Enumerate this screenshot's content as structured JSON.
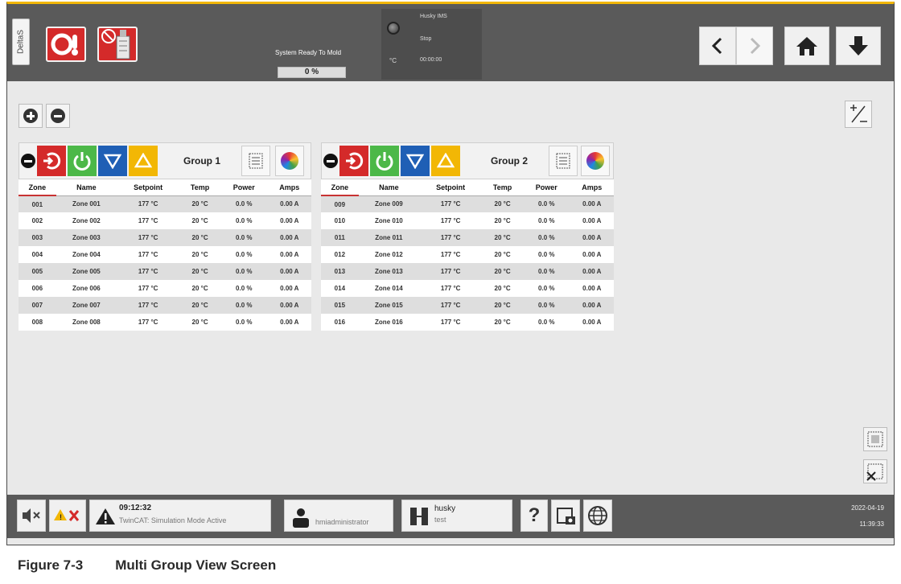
{
  "header": {
    "vertical_tab": "DeltaS",
    "status_label": "System Ready To Mold",
    "progress": "0 %",
    "ims": {
      "title": "Husky IMS",
      "state": "Stop",
      "time": "00:00:00",
      "unit": "°C"
    }
  },
  "groups": [
    {
      "title": "Group 1",
      "columns": [
        "Zone",
        "Name",
        "Setpoint",
        "Temp",
        "Power",
        "Amps"
      ],
      "rows": [
        [
          "001",
          "Zone 001",
          "177 °C",
          "20 °C",
          "0.0 %",
          "0.00 A"
        ],
        [
          "002",
          "Zone 002",
          "177 °C",
          "20 °C",
          "0.0 %",
          "0.00 A"
        ],
        [
          "003",
          "Zone 003",
          "177 °C",
          "20 °C",
          "0.0 %",
          "0.00 A"
        ],
        [
          "004",
          "Zone 004",
          "177 °C",
          "20 °C",
          "0.0 %",
          "0.00 A"
        ],
        [
          "005",
          "Zone 005",
          "177 °C",
          "20 °C",
          "0.0 %",
          "0.00 A"
        ],
        [
          "006",
          "Zone 006",
          "177 °C",
          "20 °C",
          "0.0 %",
          "0.00 A"
        ],
        [
          "007",
          "Zone 007",
          "177 °C",
          "20 °C",
          "0.0 %",
          "0.00 A"
        ],
        [
          "008",
          "Zone 008",
          "177 °C",
          "20 °C",
          "0.0 %",
          "0.00 A"
        ]
      ]
    },
    {
      "title": "Group 2",
      "columns": [
        "Zone",
        "Name",
        "Setpoint",
        "Temp",
        "Power",
        "Amps"
      ],
      "rows": [
        [
          "009",
          "Zone 009",
          "177 °C",
          "20 °C",
          "0.0 %",
          "0.00 A"
        ],
        [
          "010",
          "Zone 010",
          "177 °C",
          "20 °C",
          "0.0 %",
          "0.00 A"
        ],
        [
          "011",
          "Zone 011",
          "177 °C",
          "20 °C",
          "0.0 %",
          "0.00 A"
        ],
        [
          "012",
          "Zone 012",
          "177 °C",
          "20 °C",
          "0.0 %",
          "0.00 A"
        ],
        [
          "013",
          "Zone 013",
          "177 °C",
          "20 °C",
          "0.0 %",
          "0.00 A"
        ],
        [
          "014",
          "Zone 014",
          "177 °C",
          "20 °C",
          "0.0 %",
          "0.00 A"
        ],
        [
          "015",
          "Zone 015",
          "177 °C",
          "20 °C",
          "0.0 %",
          "0.00 A"
        ],
        [
          "016",
          "Zone 016",
          "177 °C",
          "20 °C",
          "0.0 %",
          "0.00 A"
        ]
      ]
    }
  ],
  "toolbar": {
    "plus_minus_label": "+/−"
  },
  "footer": {
    "alarm_time": "09:12:32",
    "alarm_text": "TwinCAT: Simulation Mode Active",
    "user": "hmiadministrator",
    "mold_name": "husky",
    "mold_sub": "test",
    "help": "?",
    "date": "2022-04-19",
    "time": "11:39:33"
  },
  "caption": {
    "figure": "Figure 7-3",
    "title": "Multi Group View Screen"
  },
  "colors": {
    "red": "#d42a2a",
    "green": "#4cb848",
    "blue": "#1f5fb5",
    "yellow": "#f2b705",
    "header": "#5a5a5a"
  }
}
